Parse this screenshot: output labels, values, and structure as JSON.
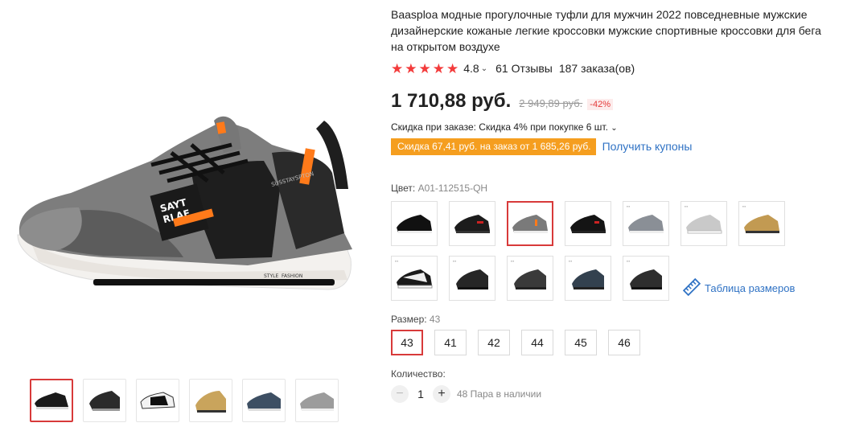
{
  "product": {
    "title": "Baasploa модные прогулочные туфли для мужчин 2022 повседневные мужские дизайнерские кожаные легкие кроссовки мужские спортивные кроссовки для бега на открытом воздухе",
    "rating": "4.8",
    "stars_filled": 5,
    "reviews": "61 Отзывы",
    "orders": "187 заказа(ов)"
  },
  "price": {
    "current": "1 710,88 руб.",
    "old": "2 949,89 руб.",
    "discount": "-42%"
  },
  "promo": {
    "order_discount": "Скидка при заказе: Скидка 4% при покупке 6 шт.",
    "coupon_tag": "Скидка 67,41 руб. на заказ от 1 685,26 руб.",
    "coupon_link": "Получить купоны",
    "coupon_color": "#f59e1f"
  },
  "main_image": {
    "shoe_text_1": "SAYT",
    "shoe_text_2": "RLAE",
    "sole_text_1": "STYLE",
    "sole_text_2": "FASHION",
    "strap_text": "SUSSTAYSPTON"
  },
  "color": {
    "label": "Цвет:",
    "value": "A01-112515-QH",
    "selected_index": 2,
    "swatches": [
      "black",
      "black-red",
      "grey-orange",
      "black-leather",
      "grey-blue",
      "light-grey",
      "gold",
      "black-white",
      "black-runner",
      "dark-grey",
      "navy",
      "black-grey"
    ]
  },
  "size_table_link": "Таблица размеров",
  "size": {
    "label": "Размер:",
    "value": "43",
    "options": [
      "43",
      "41",
      "42",
      "44",
      "45",
      "46"
    ],
    "selected_index": 0
  },
  "quantity": {
    "label": "Количество:",
    "value": "1",
    "minus": "−",
    "plus": "+",
    "stock": "48 Пара в наличии"
  },
  "thumbnails": [
    "black",
    "black-red",
    "white-black",
    "gold",
    "blue-grey",
    "grey-silver"
  ],
  "colors": {
    "accent_red": "#f33b3b",
    "link_blue": "#2f72c4",
    "selected_border": "#d83a3a"
  }
}
